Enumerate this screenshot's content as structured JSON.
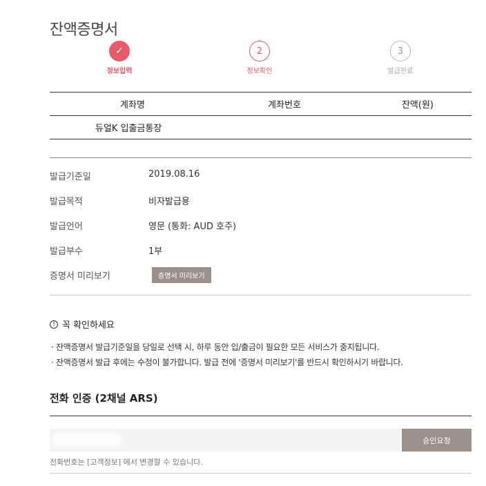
{
  "page": {
    "title": "잔액증명서"
  },
  "steps": [
    {
      "number": "✓",
      "label": "정보입력"
    },
    {
      "number": "2",
      "label": "정보확인"
    },
    {
      "number": "3",
      "label": "발급완료"
    }
  ],
  "account_table": {
    "headers": [
      "계좌명",
      "계좌번호",
      "잔액(원)"
    ],
    "rows": [
      {
        "name": "듀얼K 입출금통장",
        "number": "",
        "balance": ""
      }
    ]
  },
  "info": {
    "issue_date": {
      "label": "발급기준일",
      "value": "2019.08.16"
    },
    "purpose": {
      "label": "발급목적",
      "value": "비자발급용"
    },
    "language": {
      "label": "발급언어",
      "value": "영문 (통화: AUD 호주)"
    },
    "copies": {
      "label": "발급부수",
      "value": "1부"
    },
    "preview": {
      "label": "증명서 미리보기",
      "button": "증명서 미리보기"
    }
  },
  "notice": {
    "icon": "!",
    "title": "꼭 확인하세요",
    "items": [
      "· 잔액증명서 발급기준일을 당일로 선택 시, 하루 동안 입/출금이 필요한 모든 서비스가 중지됩니다.",
      "· 잔액증명서 발급 후에는 수정이 불가합니다. 발급 전에 '증명서 미리보기'를 반드시 확인하시기 바랍니다."
    ]
  },
  "phone_auth": {
    "title": "전화 인증 (2채널 ARS)",
    "input_value": "",
    "approve_button": "승인요청",
    "hint": "전화번호는 [고객정보] 에서 변경할 수 있습니다."
  }
}
